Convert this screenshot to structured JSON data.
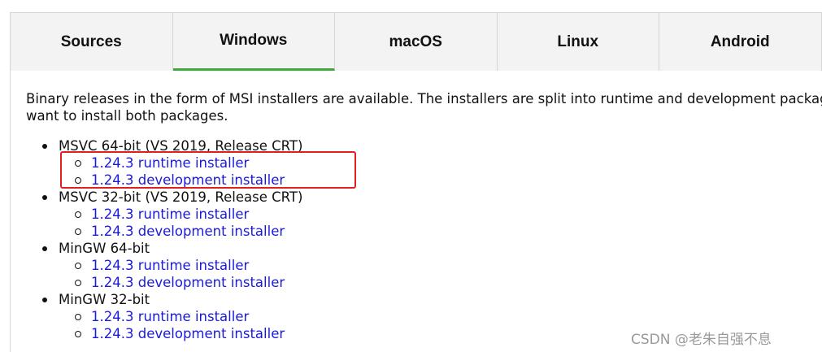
{
  "tabs": [
    {
      "label": "Sources",
      "active": false
    },
    {
      "label": "Windows",
      "active": true
    },
    {
      "label": "macOS",
      "active": false
    },
    {
      "label": "Linux",
      "active": false
    },
    {
      "label": "Android",
      "active": false
    }
  ],
  "intro": {
    "line1": "Binary releases in the form of MSI installers are available. The installers are split into runtime and development packages. For dev",
    "line2": "want to install both packages."
  },
  "builds": [
    {
      "name": "MSVC 64-bit (VS 2019, Release CRT)",
      "runtime": "1.24.3 runtime installer",
      "development": "1.24.3 development installer"
    },
    {
      "name": "MSVC 32-bit (VS 2019, Release CRT)",
      "runtime": "1.24.3 runtime installer",
      "development": "1.24.3 development installer"
    },
    {
      "name": "MinGW 64-bit",
      "runtime": "1.24.3 runtime installer",
      "development": "1.24.3 development installer"
    },
    {
      "name": "MinGW 32-bit",
      "runtime": "1.24.3 runtime installer",
      "development": "1.24.3 development installer"
    }
  ],
  "watermark": "CSDN @老朱自强不息",
  "colors": {
    "active_tab_underline": "#3caa3c",
    "link": "#1a1adc",
    "highlight_box": "#e02020"
  }
}
